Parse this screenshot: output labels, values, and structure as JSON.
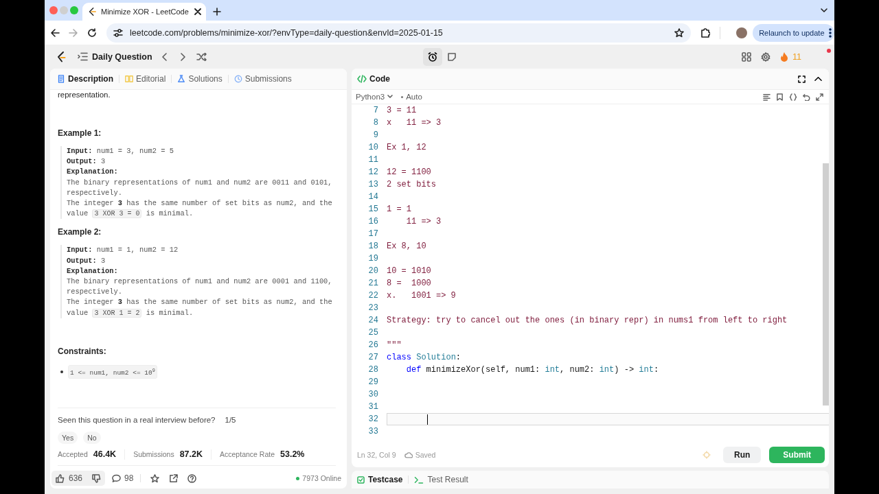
{
  "browser": {
    "tab_title": "Minimize XOR - LeetCode",
    "url": "leetcode.com/problems/minimize-xor/?envType=daily-question&envId=2025-01-15",
    "update_button": "Relaunch to update"
  },
  "topbar": {
    "title": "Daily Question",
    "streak": "11"
  },
  "problem": {
    "tabs": [
      {
        "label": "Description",
        "selected": true
      },
      {
        "label": "Editorial",
        "selected": false
      },
      {
        "label": "Solutions",
        "selected": false
      },
      {
        "label": "Submissions",
        "selected": false
      }
    ],
    "text_top": "representation.",
    "examples": [
      {
        "title": "Example 1:",
        "lines": [
          "**Input:** num1 = 3, num2 = 5",
          "**Output:** 3",
          "**Explanation:**"
        ],
        "explanation": "The binary representations of num1 and num2 are 0011 and 0101, respectively.",
        "note": "The integer **3** has the same number of set bits as num2, and the value",
        "note_code": "3 XOR 3 = 0",
        "note_end": "is minimal."
      },
      {
        "title": "Example 2:",
        "lines": [
          "**Input:** num1 = 1, num2 = 12",
          "**Output:** 3",
          "**Explanation:**"
        ],
        "explanation": "The binary representations of num1 and num2 are 0001 and 1100, respectively.",
        "note": "The integer **3** has the same number of set bits as num2, and the value",
        "note_code": "3 XOR 1 = 2",
        "note_end": "is minimal."
      }
    ],
    "constraints_title": "Constraints:",
    "constraints": [
      "1 <= num1, num2 <= 10$^{9}$"
    ],
    "interview": {
      "question": "Seen this question in a real interview before?",
      "count": "1/5",
      "answers": [
        "Yes",
        "No"
      ]
    },
    "stats": [
      {
        "label": "Accepted",
        "value": "46.4K"
      },
      {
        "label": "Submissions",
        "value": "87.2K"
      },
      {
        "label": "Acceptance Rate",
        "value": "53.2%"
      }
    ],
    "footer": {
      "likes": "636",
      "comments": "98",
      "online": "7973 Online"
    }
  },
  "editor": {
    "title": "Code",
    "language": "Python3",
    "mode": "Auto",
    "lines": [
      {
        "number": "7",
        "current": false,
        "segments": [
          {
            "kind": "comment",
            "text": "3 = 11"
          }
        ]
      },
      {
        "number": "8",
        "current": false,
        "segments": [
          {
            "kind": "comment",
            "text": "x   11 => 3"
          }
        ]
      },
      {
        "number": "9",
        "current": false
      },
      {
        "number": "10",
        "current": false,
        "segments": [
          {
            "kind": "comment",
            "text": "Ex 1, 12"
          }
        ]
      },
      {
        "number": "11",
        "current": false
      },
      {
        "number": "12",
        "current": false,
        "segments": [
          {
            "kind": "comment",
            "text": "12 = 1100"
          }
        ]
      },
      {
        "number": "13",
        "current": false,
        "segments": [
          {
            "kind": "comment",
            "text": "2 set bits"
          }
        ]
      },
      {
        "number": "14",
        "current": false
      },
      {
        "number": "15",
        "current": false,
        "segments": [
          {
            "kind": "comment",
            "text": "1 = 1"
          }
        ]
      },
      {
        "number": "16",
        "current": false,
        "segments": [
          {
            "kind": "comment",
            "text": "    11 => 3"
          }
        ]
      },
      {
        "number": "17",
        "current": false
      },
      {
        "number": "18",
        "current": false,
        "segments": [
          {
            "kind": "comment",
            "text": "Ex 8, 10"
          }
        ]
      },
      {
        "number": "19",
        "current": false
      },
      {
        "number": "20",
        "current": false,
        "segments": [
          {
            "kind": "comment",
            "text": "10 = 1010"
          }
        ]
      },
      {
        "number": "21",
        "current": false,
        "segments": [
          {
            "kind": "comment",
            "text": "8 =  1000"
          }
        ]
      },
      {
        "number": "22",
        "current": false,
        "segments": [
          {
            "kind": "comment",
            "text": "x.   1001 => 9"
          }
        ]
      },
      {
        "number": "23",
        "current": false
      },
      {
        "number": "24",
        "current": false,
        "segments": [
          {
            "kind": "comment",
            "text": "Strategy: try to cancel out the ones (in binary repr) in nums1 from left to right"
          }
        ]
      },
      {
        "number": "25",
        "current": false
      },
      {
        "number": "26",
        "current": false,
        "segments": [
          {
            "kind": "comment",
            "text": "\"\"\""
          }
        ]
      },
      {
        "number": "27",
        "current": false,
        "segments": [
          {
            "kind": "keyword",
            "text": "class"
          },
          {
            "kind": "type",
            "text": " Solution"
          },
          {
            "kind": "plain",
            "text": ":"
          }
        ]
      },
      {
        "number": "28",
        "current": false,
        "segments": [
          {
            "kind": "keyword",
            "text": "    def"
          },
          {
            "kind": "plain",
            "text": " minimizeXor(self, num1: "
          },
          {
            "kind": "type",
            "text": "int"
          },
          {
            "kind": "plain",
            "text": ", num2: "
          },
          {
            "kind": "type",
            "text": "int"
          },
          {
            "kind": "plain",
            "text": ") -> "
          },
          {
            "kind": "type",
            "text": "int"
          },
          {
            "kind": "plain",
            "text": ":"
          }
        ]
      },
      {
        "number": "29",
        "current": false
      },
      {
        "number": "30",
        "current": false
      },
      {
        "number": "31",
        "current": false
      },
      {
        "number": "32",
        "current": true
      },
      {
        "number": "33",
        "current": false
      }
    ],
    "position": "Ln 32, Col 9",
    "save_status": "Saved",
    "buttons": [
      {
        "label": "Run",
        "kind": "secondary"
      },
      {
        "label": "Submit",
        "kind": "primary"
      }
    ]
  },
  "bottom_tabs": [
    {
      "label": "Testcase",
      "selected": true
    },
    {
      "label": "Test Result",
      "selected": false
    }
  ]
}
